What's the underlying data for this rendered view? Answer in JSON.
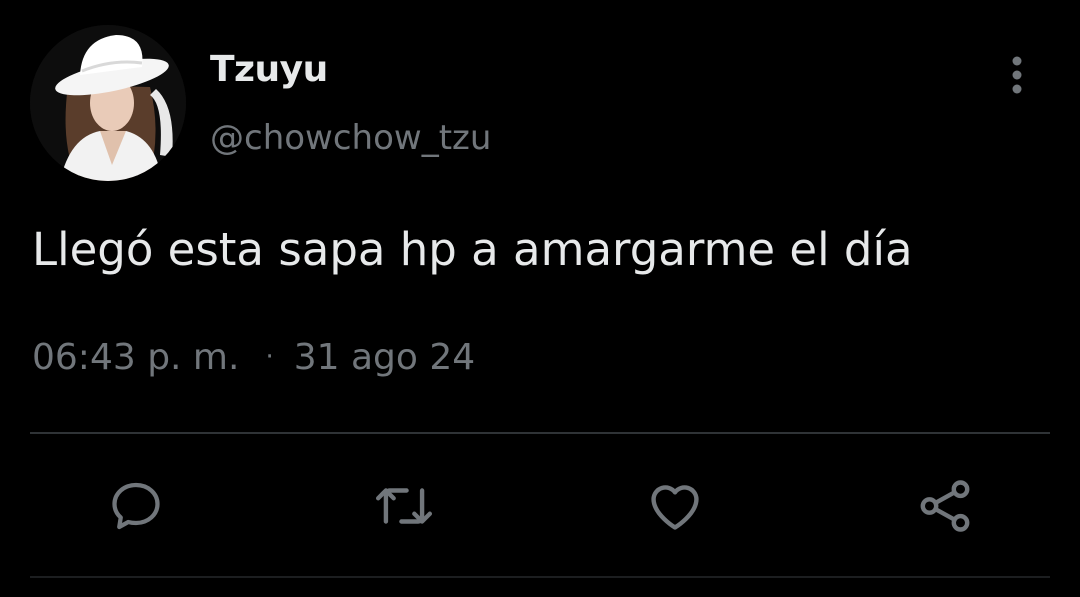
{
  "tweet": {
    "display_name": "Tzuyu",
    "handle": "@chowchow_tzu",
    "text": "Llegó esta sapa hp a amargarme el día",
    "time": "06:43 p. m.",
    "separator": "·",
    "date": "31 ago 24"
  },
  "actions": {
    "reply_icon": "speech-bubble-icon",
    "retweet_icon": "retweet-icon",
    "like_icon": "heart-icon",
    "share_icon": "share-nodes-icon"
  },
  "colors": {
    "background": "#000000",
    "primary_text": "#e7e9ea",
    "secondary_text": "#71767b",
    "divider": "#2f3336"
  }
}
